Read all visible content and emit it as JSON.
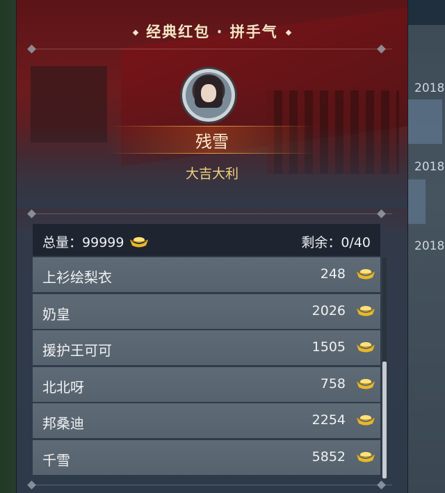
{
  "window": {
    "title": "经典红包 · 拼手气"
  },
  "sender": {
    "name": "残雪",
    "blessing": "大吉大利",
    "avatar_icon": "character-portrait"
  },
  "summary": {
    "total_label": "总量：",
    "total_value": "99999",
    "remaining_label": "剩余：",
    "remaining_value": "0/40"
  },
  "recipients": [
    {
      "name": "上衫绘梨衣",
      "amount": "248"
    },
    {
      "name": "奶皇",
      "amount": "2026"
    },
    {
      "name": "援护王可可",
      "amount": "1505"
    },
    {
      "name": "北北呀",
      "amount": "758"
    },
    {
      "name": "邦桑迪",
      "amount": "2254"
    },
    {
      "name": "千雪",
      "amount": "5852"
    }
  ],
  "currency_icon": "gold-ingot-icon",
  "background": {
    "years": [
      "2018",
      "2018",
      "2018"
    ]
  },
  "colors": {
    "accent_gold": "#f1d27a",
    "panel_red": "#6d1b1d",
    "row_bg": "#5e6a75"
  }
}
